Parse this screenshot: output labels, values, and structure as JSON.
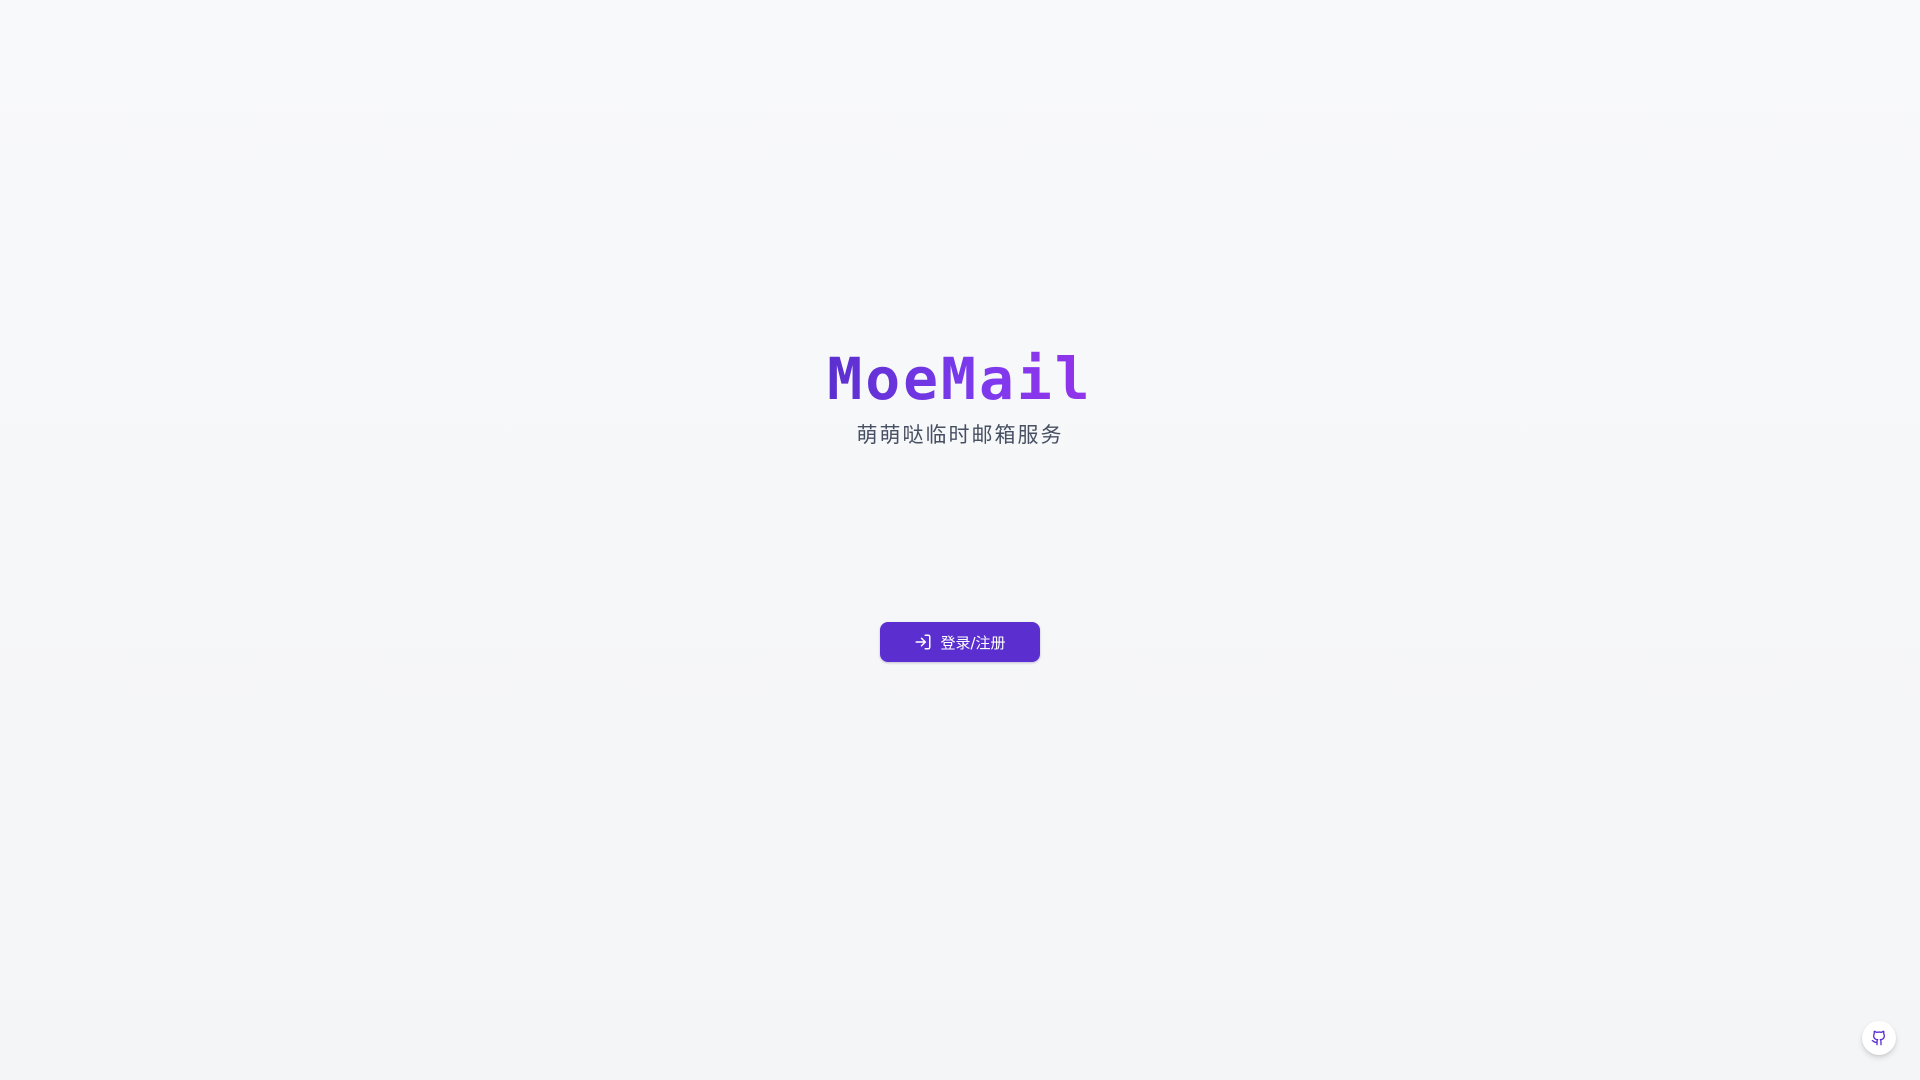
{
  "app": {
    "logo_text": "MoeMail",
    "tagline": "萌萌哒临时邮箱服务"
  },
  "actions": {
    "login_label": "登录/注册"
  },
  "icons": {
    "login": "log-in-icon",
    "github": "github-icon"
  },
  "colors": {
    "accent": "#5b2fcf",
    "accent_light": "#9333ea",
    "background": "#f6f7f9",
    "tagline_text": "#475063"
  }
}
